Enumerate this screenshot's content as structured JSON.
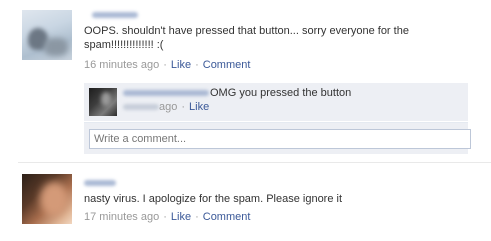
{
  "stories": [
    {
      "message": "OOPS. shouldn't have pressed that button... sorry everyone for the spam!!!!!!!!!!!!!! :(",
      "timestamp": "16 minutes ago",
      "like_label": "Like",
      "comment_label": "Comment",
      "comments": [
        {
          "text": "OMG you pressed the button",
          "timestamp_fragment": "ago",
          "like_label": "Like"
        }
      ],
      "write_comment_placeholder": "Write a comment..."
    },
    {
      "message": "nasty virus. I apologize for the spam. Please ignore it",
      "timestamp": "17 minutes ago",
      "like_label": "Like",
      "comment_label": "Comment"
    }
  ],
  "separator": "·",
  "colors": {
    "link": "#3b5998",
    "meta_text": "#999999",
    "comment_background": "#edeff4",
    "body_text": "#333333"
  }
}
